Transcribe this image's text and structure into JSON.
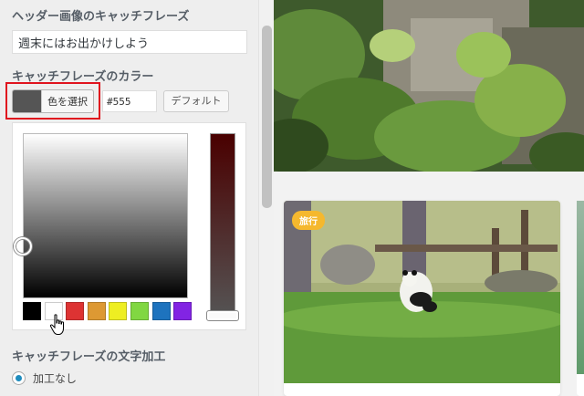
{
  "panel": {
    "catchphrase_section_label": "ヘッダー画像のキャッチフレーズ",
    "catchphrase_value": "週末にはお出かけしよう",
    "color_section_label": "キャッチフレーズのカラー",
    "color_picker_button_label": "色を選択",
    "selected_color": "#555555",
    "hex_value": "#555",
    "default_button_label": "デフォルト",
    "palette": [
      "#000000",
      "#ffffff",
      "#dd3333",
      "#dd9933",
      "#eeee22",
      "#81d742",
      "#1e73be",
      "#8224e3"
    ],
    "text_decoration_section_label": "キャッチフレーズの文字加工",
    "text_decoration_option_label": "加工なし"
  },
  "preview": {
    "card_category_badge": "旅行"
  },
  "colors": {
    "accent": "#1e8cbe",
    "highlight": "#e0141e",
    "badge": "#f5b82e"
  }
}
